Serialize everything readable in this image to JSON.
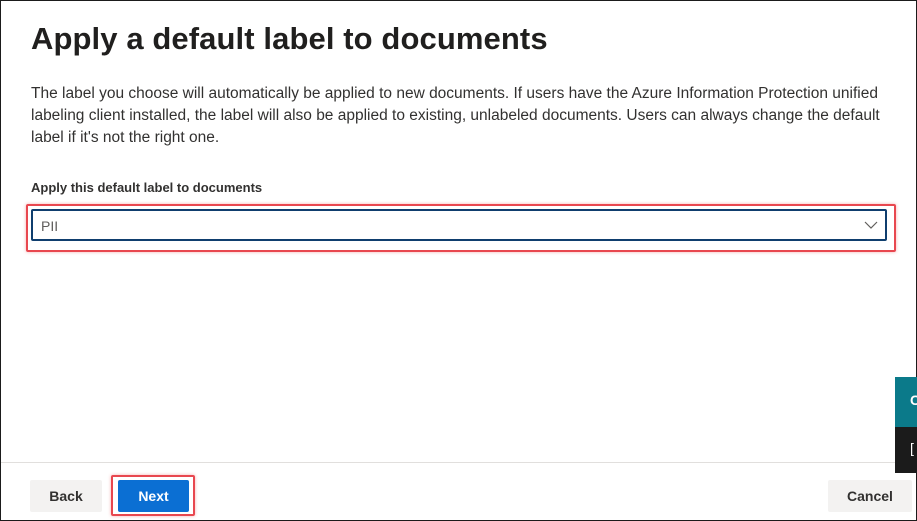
{
  "page": {
    "title": "Apply a default label to documents",
    "description": "The label you choose will automatically be applied to new documents. If users have the Azure Information Protection unified labeling client installed, the label will also be applied to existing, unlabeled documents. Users can always change the default label if it's not the right one."
  },
  "default_label_field": {
    "label": "Apply this default label to documents",
    "selected_value": "PII",
    "icon": "chevron-down-icon"
  },
  "footer": {
    "back_label": "Back",
    "next_label": "Next",
    "cancel_label": "Cancel"
  },
  "side_widgets": {
    "teal_glyph": "C",
    "dark_glyph": "[",
    "teal_color": "#0b7a8a",
    "dark_color": "#1b1b1b"
  },
  "colors": {
    "primary": "#0b6fd3",
    "highlight": "#e8474f",
    "select_border": "#0f3e6e"
  }
}
